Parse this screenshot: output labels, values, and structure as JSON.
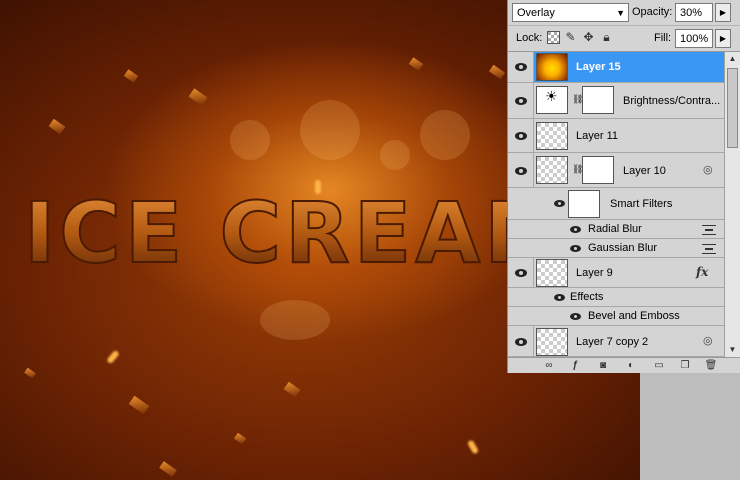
{
  "canvas": {
    "artwork_text": "ICE CREAM"
  },
  "layers_panel": {
    "blend_mode": "Overlay",
    "opacity_label": "Opacity:",
    "opacity_value": "30%",
    "lock_label": "Lock:",
    "fill_label": "Fill:",
    "fill_value": "100%",
    "layers": [
      {
        "name": "Layer 15",
        "selected": true
      },
      {
        "name": "Brightness/Contra..."
      },
      {
        "name": "Layer 11"
      },
      {
        "name": "Layer 10"
      },
      {
        "name": "Smart Filters"
      },
      {
        "name": "Radial Blur"
      },
      {
        "name": "Gaussian Blur"
      },
      {
        "name": "Layer 9"
      },
      {
        "name": "Effects"
      },
      {
        "name": "Bevel and Emboss"
      },
      {
        "name": "Layer 7 copy 2"
      }
    ],
    "icons": {
      "visibility": "eye-icon",
      "link": "chain-icon",
      "fx": "fx"
    },
    "colors": {
      "selected_row": "#3b97f4",
      "panel_bg": "#d4d4d4"
    }
  }
}
